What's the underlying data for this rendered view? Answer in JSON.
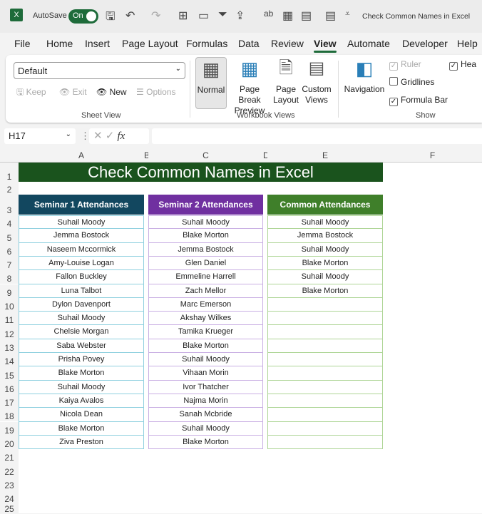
{
  "titlebar": {
    "autosave": "AutoSave",
    "toggle": "On",
    "doc_title": "Check Common Names in Excel"
  },
  "menu": [
    "File",
    "Home",
    "Insert",
    "Page Layout",
    "Formulas",
    "Data",
    "Review",
    "View",
    "Automate",
    "Developer",
    "Help"
  ],
  "ribbon": {
    "sheet_view": {
      "select": "Default",
      "keep": "Keep",
      "exit": "Exit",
      "new": "New",
      "options": "Options",
      "label": "Sheet View"
    },
    "workbook_views": {
      "normal": "Normal",
      "page_break_1": "Page Break",
      "page_break_2": "Preview",
      "page_layout_1": "Page",
      "page_layout_2": "Layout",
      "custom_1": "Custom",
      "custom_2": "Views",
      "label": "Workbook Views"
    },
    "show": {
      "navigation": "Navigation",
      "ruler": "Ruler",
      "gridlines": "Gridlines",
      "formula_bar": "Formula Bar",
      "headings": "Hea",
      "label": "Show",
      "ruler_checked": true,
      "gridlines_checked": false,
      "formula_bar_checked": true,
      "headings_checked": true
    }
  },
  "formula_bar": {
    "name_box": "H17",
    "fx": "fx",
    "value": ""
  },
  "columns": [
    "A",
    "B",
    "C",
    "D",
    "E",
    "F"
  ],
  "rows": [
    "1",
    "2",
    "3",
    "4",
    "5",
    "6",
    "7",
    "8",
    "9",
    "10",
    "11",
    "12",
    "13",
    "14",
    "15",
    "16",
    "17",
    "18",
    "19",
    "20",
    "21",
    "22",
    "23",
    "24",
    "25"
  ],
  "sheet": {
    "title": "Check Common Names in Excel",
    "headers": [
      "Seminar 1 Attendances",
      "Seminar 2 Attendances",
      "Common Attendances"
    ],
    "seminar1": [
      "Suhail Moody",
      "Jemma Bostock",
      "Naseem Mccormick",
      "Amy-Louise Logan",
      "Fallon Buckley",
      "Luna Talbot",
      "Dylon Davenport",
      "Suhail Moody",
      "Chelsie Morgan",
      "Saba Webster",
      "Prisha Povey",
      "Blake Morton",
      "Suhail Moody",
      "Kaiya Avalos",
      "Nicola Dean",
      "Blake Morton",
      "Ziva Preston"
    ],
    "seminar2": [
      "Suhail Moody",
      "Blake Morton",
      "Jemma Bostock",
      "Glen Daniel",
      "Emmeline Harrell",
      "Zach Mellor",
      "Marc Emerson",
      "Akshay Wilkes",
      "Tamika Krueger",
      "Blake Morton",
      "Suhail Moody",
      "Vihaan Morin",
      "Ivor Thatcher",
      "Najma Morin",
      "Sanah Mcbride",
      "Suhail Moody",
      "Blake Morton"
    ],
    "common": [
      "Suhail Moody",
      "Jemma Bostock",
      "Suhail Moody",
      "Blake Morton",
      "Suhail Moody",
      "Blake Morton",
      "",
      "",
      "",
      "",
      "",
      "",
      "",
      "",
      "",
      "",
      ""
    ]
  },
  "colors": {
    "title_bg": "#1a531d",
    "seminar1": "#12475f",
    "seminar2": "#7030a0",
    "common": "#3f7f2a",
    "accent": "#1e6b3a"
  }
}
